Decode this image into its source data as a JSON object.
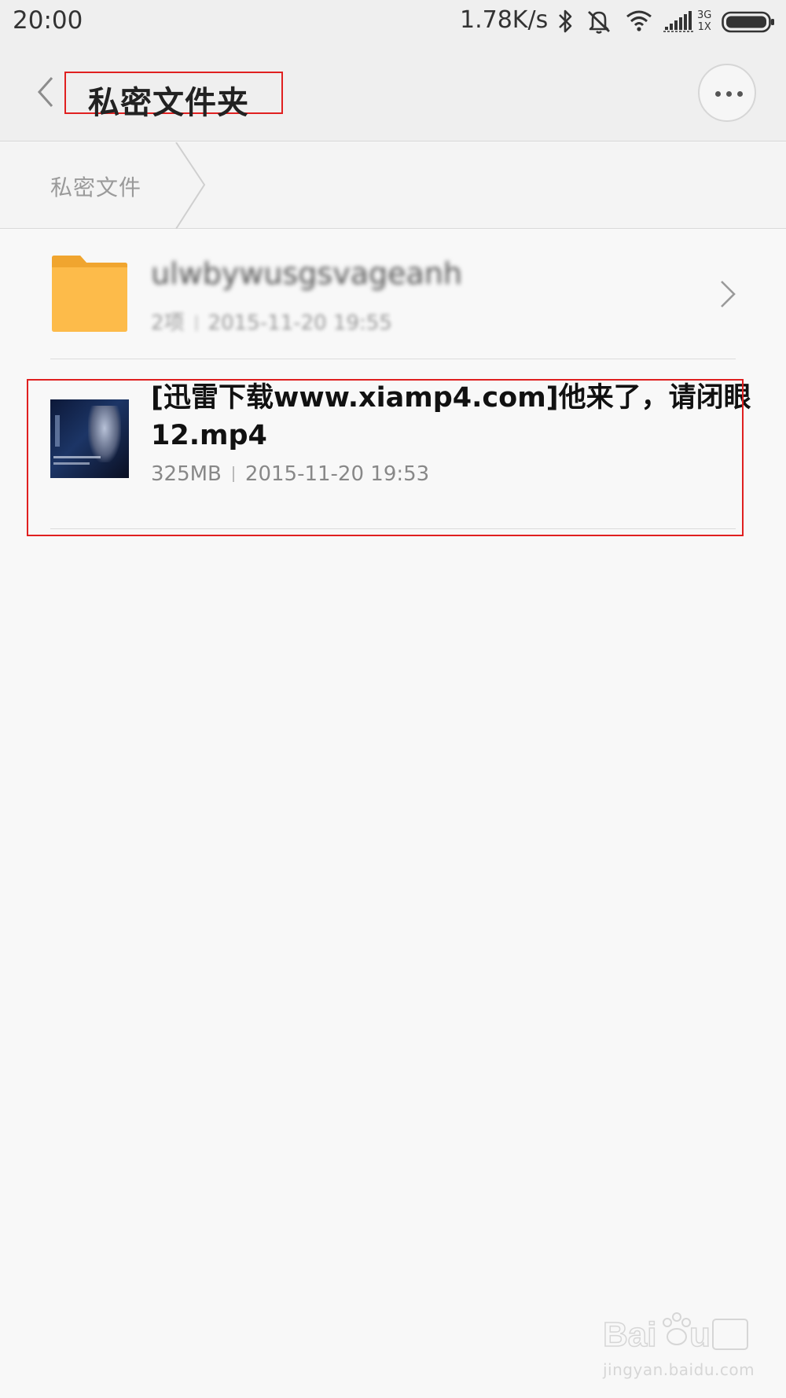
{
  "status_bar": {
    "time": "20:00",
    "net_speed": "1.78K/s",
    "net_type_top": "3G",
    "net_type_bottom": "1X",
    "icons": [
      "bluetooth-icon",
      "mute-icon",
      "wifi-icon",
      "signal-icon",
      "battery-icon"
    ]
  },
  "header": {
    "title": "私密文件夹",
    "back_icon": "back-icon",
    "more_icon": "more-icon"
  },
  "breadcrumb": {
    "label": "私密文件"
  },
  "files": [
    {
      "type": "folder",
      "name": "ulwbywusgsvageanh",
      "count": "2项",
      "date": "2015-11-20 19:55",
      "icon": "folder-icon",
      "colors": {
        "folder": "#fdbb4a",
        "folder_tab": "#f0a52f"
      }
    },
    {
      "type": "video",
      "name": "[迅雷下载www.xiamp4.com]他来了，请闭眼12.mp4",
      "size": "325MB",
      "date": "2015-11-20 19:53"
    }
  ],
  "watermark": {
    "text": "jingyan.baidu.com"
  },
  "colors": {
    "highlight": "#e02020",
    "background": "#f8f8f8",
    "header_bg": "#efefef"
  }
}
